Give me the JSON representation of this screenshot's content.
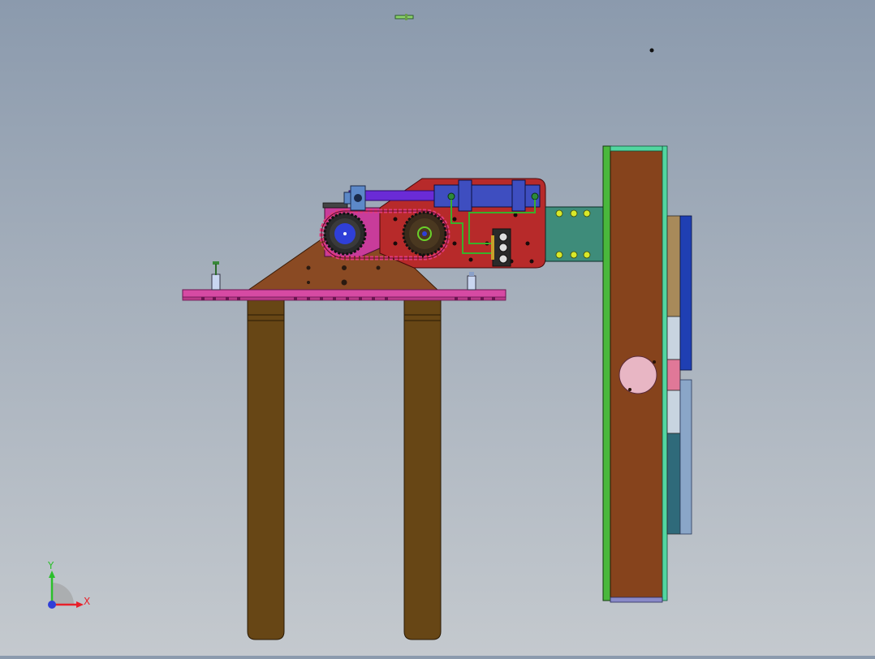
{
  "viewport": {
    "background_top": "#8b9aad",
    "background_bottom": "#c4c9ce"
  },
  "triad": {
    "x_label": "X",
    "y_label": "Y",
    "x_color": "#e8202a",
    "y_color": "#2bbf2b",
    "z_color": "#2f3fd8"
  },
  "colors": {
    "fork_brown": "#674615",
    "base_magenta": "#d64aa3",
    "bracket_brown": "#8a4a23",
    "housing_red": "#b72a2a",
    "cylinder_blue": "#3e4ec0",
    "rod_purple": "#6a2bd6",
    "teal_link": "#3e8c7a",
    "mast_brown": "#86431c",
    "mast_green": "#4ab83c",
    "panel_blue": "#1f3fb3",
    "panel_lightblue": "#8aa6c8",
    "disk_pink": "#e8b6c4"
  },
  "icons": {
    "triad": "coordinate-triad-icon"
  }
}
